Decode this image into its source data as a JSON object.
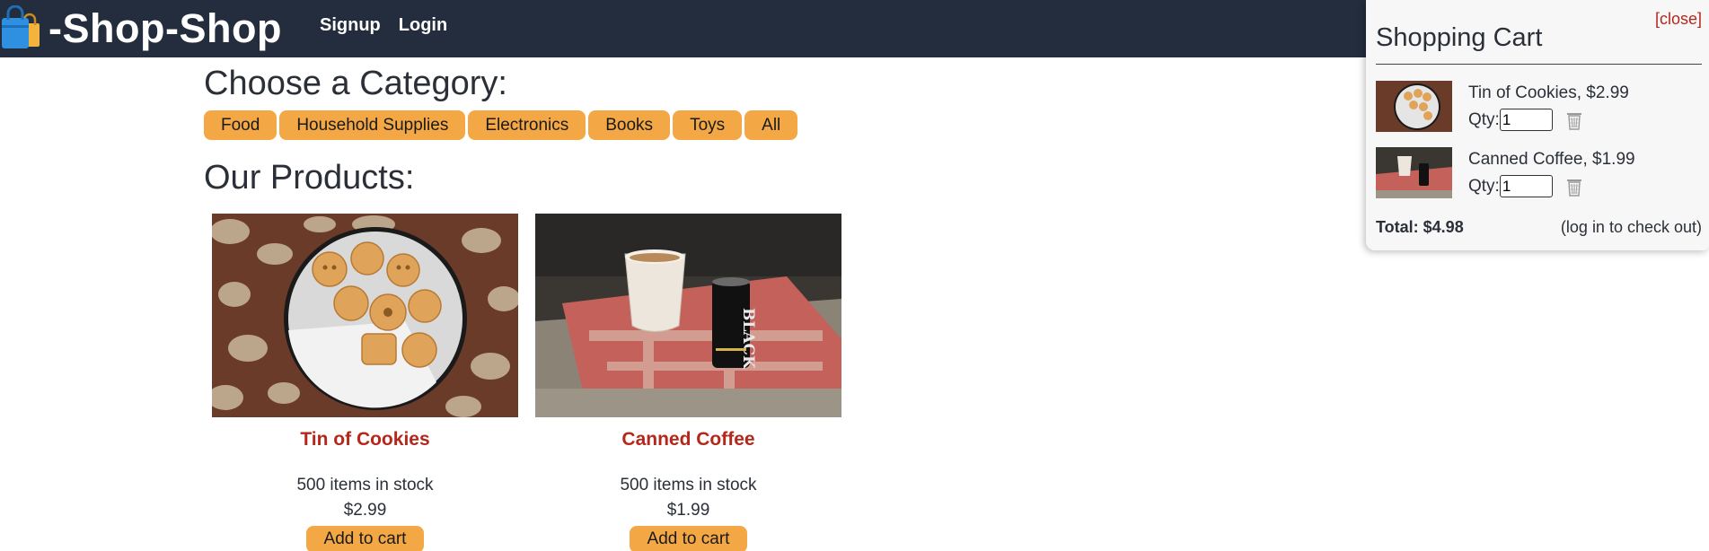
{
  "header": {
    "title": "-Shop-Shop",
    "nav": [
      {
        "label": "Signup"
      },
      {
        "label": "Login"
      }
    ]
  },
  "categories": {
    "title": "Choose a Category:",
    "items": [
      {
        "label": "Food"
      },
      {
        "label": "Household Supplies"
      },
      {
        "label": "Electronics"
      },
      {
        "label": "Books"
      },
      {
        "label": "Toys"
      },
      {
        "label": "All"
      }
    ]
  },
  "products": {
    "title": "Our Products:",
    "items": [
      {
        "name": "Tin of Cookies",
        "stock": "500 items in stock",
        "price": "$2.99",
        "button": "Add to cart"
      },
      {
        "name": "Canned Coffee",
        "stock": "500 items in stock",
        "price": "$1.99",
        "button": "Add to cart"
      }
    ]
  },
  "cart": {
    "close_label": "[close]",
    "title": "Shopping Cart",
    "items": [
      {
        "name": "Tin of Cookies, $2.99",
        "qty_label": "Qty:",
        "qty": "1"
      },
      {
        "name": "Canned Coffee, $1.99",
        "qty_label": "Qty:",
        "qty": "1"
      }
    ],
    "total": "Total: $4.98",
    "checkout_note": "(log in to check out)"
  },
  "colors": {
    "header_bg": "#232d3d",
    "accent_button": "#f3a845",
    "product_name": "#b5271b",
    "cart_bg": "#f7f7f7"
  }
}
